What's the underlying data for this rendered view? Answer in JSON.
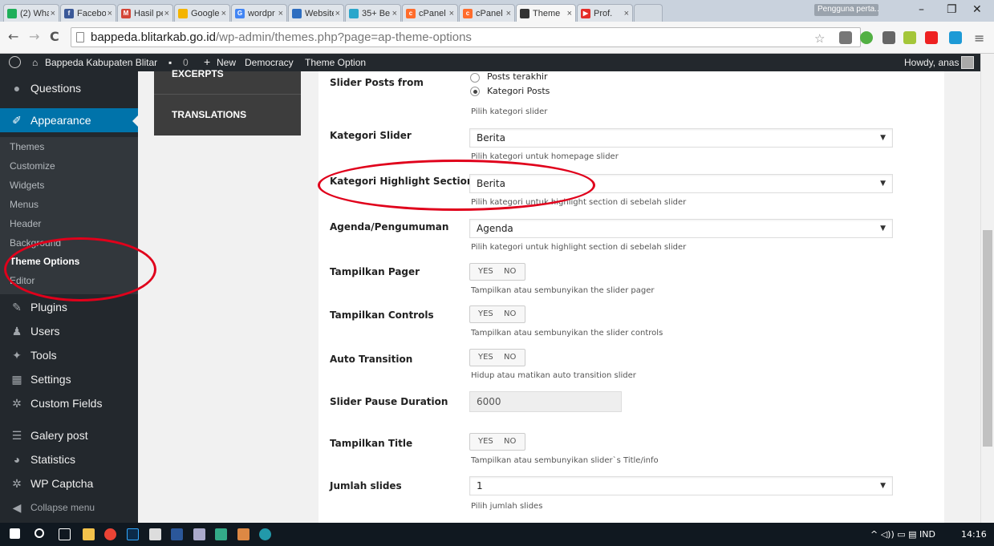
{
  "browser": {
    "tabs": [
      {
        "label": "(2) Wha",
        "color": "#1faf5a"
      },
      {
        "label": "Facebo",
        "color": "#3b5998"
      },
      {
        "label": "Hasil pe",
        "color": "#d44638"
      },
      {
        "label": "Google",
        "color": "#f4b400"
      },
      {
        "label": "wordpr",
        "color": "#4285f4"
      },
      {
        "label": "Website",
        "color": "#2e6ec0"
      },
      {
        "label": "35+ Be",
        "color": "#2ba6cb"
      },
      {
        "label": "cPanel",
        "color": "#ff6c2c"
      },
      {
        "label": "cPanel F",
        "color": "#ff6c2c"
      },
      {
        "label": "Theme",
        "color": "#333333"
      },
      {
        "label": "Prof.",
        "color": "#e52d27"
      }
    ],
    "profile_chip": "Pengguna perta...",
    "url_domain": "bappeda.blitarkab.go.id",
    "url_path": "/wp-admin/themes.php?page=ap-theme-options"
  },
  "adminbar": {
    "site_name": "Bappeda Kabupaten Blitar",
    "comments_count": "0",
    "new_label": "New",
    "items": [
      "Democracy",
      "Theme Option"
    ],
    "greeting": "Howdy, anas"
  },
  "sidebar": {
    "top_items": [
      {
        "label": "Questions",
        "icon": "question-circle-icon"
      }
    ],
    "appearance": "Appearance",
    "submenu": [
      "Themes",
      "Customize",
      "Widgets",
      "Menus",
      "Header",
      "Background",
      "Theme Options",
      "Editor"
    ],
    "bottom_items": [
      {
        "label": "Plugins",
        "icon": "plug-icon"
      },
      {
        "label": "Users",
        "icon": "users-icon"
      },
      {
        "label": "Tools",
        "icon": "wrench-icon"
      },
      {
        "label": "Settings",
        "icon": "settings-icon"
      },
      {
        "label": "Custom Fields",
        "icon": "gear-icon"
      },
      {
        "label": "Galery post",
        "icon": "gallery-icon"
      },
      {
        "label": "Statistics",
        "icon": "pie-chart-icon"
      },
      {
        "label": "WP Captcha",
        "icon": "gear-icon"
      },
      {
        "label": "Collapse menu",
        "icon": "collapse-icon"
      }
    ]
  },
  "options_nav": [
    "EXCERPTS",
    "TRANSLATIONS"
  ],
  "options": {
    "slider_posts_from": {
      "label": "Slider Posts from",
      "choices": [
        "Posts terakhir",
        "Kategori Posts"
      ],
      "selected": "Kategori Posts",
      "help": "Pilih kategori slider"
    },
    "kategori_slider": {
      "label": "Kategori Slider",
      "value": "Berita",
      "help": "Pilih kategori untuk homepage slider"
    },
    "kategori_highlight": {
      "label": "Kategori Highlight Section",
      "value": "Berita",
      "help": "Pilih kategori untuk highlight section di sebelah slider"
    },
    "agenda": {
      "label": "Agenda/Pengumuman",
      "value": "Agenda",
      "help": "Pilih kategori untuk highlight section di sebelah slider"
    },
    "tampilkan_pager": {
      "label": "Tampilkan Pager",
      "yes": "YES",
      "no": "NO",
      "help": "Tampilkan atau sembunyikan the slider pager"
    },
    "tampilkan_controls": {
      "label": "Tampilkan Controls",
      "yes": "YES",
      "no": "NO",
      "help": "Tampilkan atau sembunyikan the slider controls"
    },
    "auto_transition": {
      "label": "Auto Transition",
      "yes": "YES",
      "no": "NO",
      "help": "Hidup atau matikan auto transition slider"
    },
    "slider_pause": {
      "label": "Slider Pause Duration",
      "value": "6000"
    },
    "tampilkan_title": {
      "label": "Tampilkan Title",
      "yes": "YES",
      "no": "NO",
      "help": "Tampilkan atau sembunyikan slider`s Title/info"
    },
    "jumlah_slides": {
      "label": "Jumlah slides",
      "value": "1",
      "help": "Pilih jumlah slides"
    }
  },
  "taskbar": {
    "language": "IND",
    "time": "14:16"
  },
  "colors": {
    "accent": "#0073aa",
    "annotation": "#e0001b",
    "adminbar": "#23282d"
  }
}
